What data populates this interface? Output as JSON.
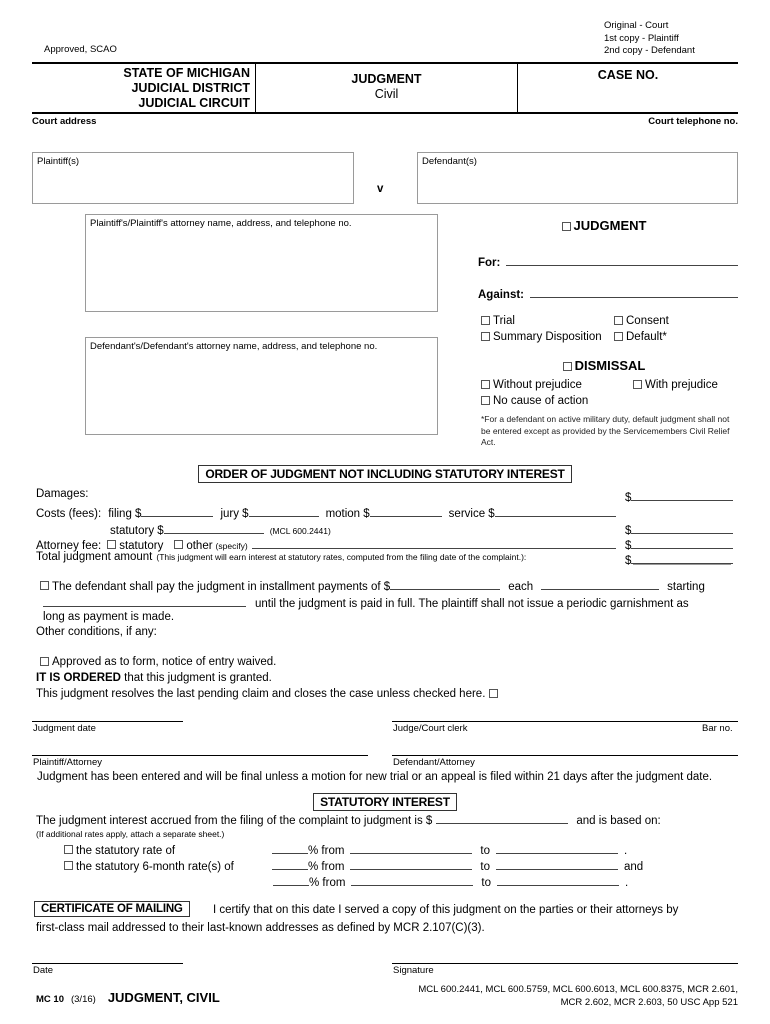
{
  "meta": {
    "approved": "Approved,  SCAO",
    "copies": [
      "Original - Court",
      "1st copy - Plaintiff",
      "2nd copy - Defendant"
    ]
  },
  "header": {
    "state_line1": "STATE OF MICHIGAN",
    "state_line2": "JUDICIAL DISTRICT",
    "state_line3": "JUDICIAL CIRCUIT",
    "form_title": "JUDGMENT",
    "form_subtitle": "Civil",
    "case_no_label": "CASE NO.",
    "court_address_label": "Court  address",
    "court_phone_label": "Court  telephone  no."
  },
  "parties": {
    "plaintiff_label": "Plaintiff(s)",
    "defendant_label": "Defendant(s)",
    "versus": "v",
    "plaintiff_attorney_label": "Plaintiff's/Plaintiff's  attorney name, address, and telephone no.",
    "defendant_attorney_label": "Defendant's/Defendant's attorney name, address, and telephone no."
  },
  "judgment_panel": {
    "judgment_label": "JUDGMENT",
    "for_label": "For:",
    "against_label": "Against:",
    "options": [
      "Trial",
      "Consent",
      "Summary Disposition",
      "Default*"
    ],
    "dismissal_label": "DISMISSAL",
    "dismissal_options": [
      "Without prejudice",
      "With prejudice",
      "No cause of action"
    ],
    "footnote": "*For a defendant on active military duty, default judgment shall not be entered except as provided by the Servicemembers Civil Relief Act."
  },
  "order": {
    "banner": "ORDER OF JUDGMENT NOT INCLUDING STATUTORY INTEREST",
    "damages_label": "Damages:",
    "costs_label": "Costs (fees):",
    "costs_filing": "filing $",
    "costs_jury": "jury $",
    "costs_motion": "motion $",
    "costs_service": "service  $",
    "costs_statutory": "statutory $",
    "costs_statutory_cite": "(MCL 600.2441)",
    "attorney_fee_label": "Attorney fee:",
    "attorney_fee_statutory": "statutory",
    "attorney_fee_other": "other",
    "attorney_fee_specify": "(specify)",
    "total_label": "Total judgment amount",
    "total_note": "(This judgment will earn interest at statutory rates, computed from the filing date of the complaint.):",
    "dollar": "$"
  },
  "installment": {
    "part1": "The defendant shall pay the judgment in installment payments of $",
    "part2": "each",
    "part3": "starting",
    "part4": "until the judgment is paid in full.  The plaintiff shall not issue a periodic garnishment as",
    "part5": "long as payment is made.",
    "other_conditions": "Other conditions, if any:"
  },
  "orders": {
    "approved_form": "Approved as to form, notice of entry waived.",
    "it_is_ordered_bold": "IT IS ORDERED",
    "it_is_ordered_rest": " that this judgment is granted.",
    "resolves": "This judgment resolves the last pending claim and closes the case unless checked here."
  },
  "signatures": {
    "judgment_date": "Judgment date",
    "judge_clerk": "Judge/Court clerk",
    "bar_no": "Bar no.",
    "plaintiff_attorney": "Plaintiff/Attorney",
    "defendant_attorney": "Defendant/Attorney",
    "final_notice": "Judgment has been entered and will be final unless a motion for new trial or an appeal is filed within 21 days after the judgment date."
  },
  "statutory_interest": {
    "banner": "STATUTORY INTEREST",
    "accrued_part1": "The judgment interest accrued from the filing of the complaint to judgment is $",
    "accrued_part2": "and is based on:",
    "additional_note": "(If additional rates apply, attach a separate sheet.)",
    "rate_rows": [
      {
        "label": "the statutory rate of",
        "checkbox": true,
        "pct": "% from",
        "to": "to",
        "suffix": "."
      },
      {
        "label": "the statutory 6-month rate(s) of",
        "checkbox": true,
        "pct": "% from",
        "to": "to",
        "suffix": "and"
      },
      {
        "label": "",
        "checkbox": false,
        "pct": "% from",
        "to": "to",
        "suffix": "."
      }
    ]
  },
  "certificate": {
    "banner": "CERTIFICATE OF MAILING",
    "text1": "I certify that on this date I served a copy of this judgment on the parties or their attorneys by",
    "text2": "first-class mail addressed to their last-known addresses as defined by MCR 2.107(C)(3).",
    "date_label": "Date",
    "signature_label": "Signature"
  },
  "footer": {
    "form_no": "MC 10",
    "revision": "(3/16)",
    "form_name": "JUDGMENT, CIVIL",
    "citations_line1": "MCL 600.2441, MCL 600.5759, MCL 600.6013, MCL 600.8375, MCR 2.601,",
    "citations_line2": "MCR 2.602, MCR 2.603, 50 USC App 521"
  }
}
